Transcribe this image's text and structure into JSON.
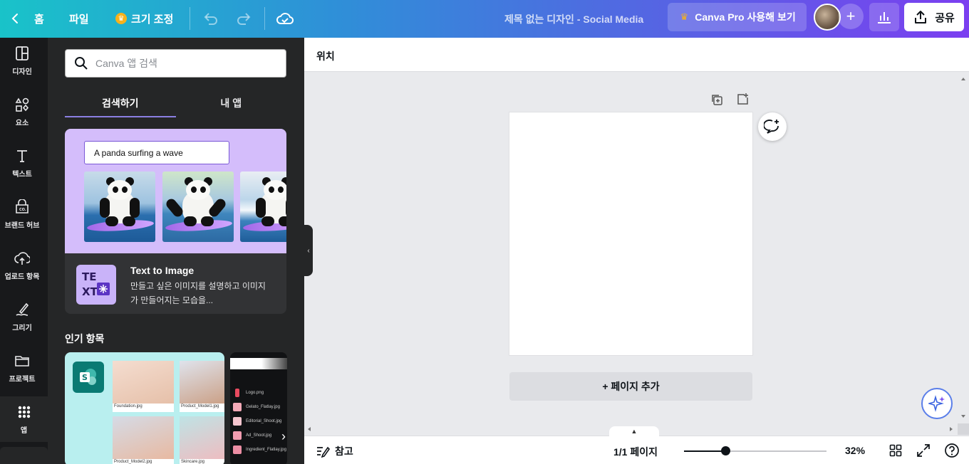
{
  "topbar": {
    "home_label": "홈",
    "file_label": "파일",
    "resize_label": "크기 조정",
    "title": "제목 없는 디자인 - Social Media",
    "pro_label": "Canva Pro 사용해 보기",
    "share_label": "공유"
  },
  "rail": {
    "items": [
      {
        "label": "디자인",
        "icon": "design-icon"
      },
      {
        "label": "요소",
        "icon": "elements-icon"
      },
      {
        "label": "텍스트",
        "icon": "text-icon"
      },
      {
        "label": "브랜드 허브",
        "icon": "brand-hub-icon"
      },
      {
        "label": "업로드 항목",
        "icon": "upload-icon"
      },
      {
        "label": "그리기",
        "icon": "draw-icon"
      },
      {
        "label": "프로젝트",
        "icon": "folder-icon"
      },
      {
        "label": "앱",
        "icon": "apps-grid-icon",
        "active": true
      }
    ]
  },
  "panel": {
    "search_placeholder": "Canva 앱 검색",
    "tabs": [
      {
        "label": "검색하기",
        "active": true
      },
      {
        "label": "내 앱",
        "active": false
      }
    ],
    "t2i": {
      "prompt": "A panda surfing a wave",
      "name": "Text to Image",
      "desc": "만들고 싶은 이미지를 설명하고 이미지가 만들어지는 모습을..."
    },
    "popular_title": "인기 항목",
    "thumbs": [
      {
        "caption": "Foundation.jpg"
      },
      {
        "caption": "Product_Model1.jpg"
      },
      {
        "caption": "Product_Model2.jpg"
      },
      {
        "caption": "Skincare.jpg"
      }
    ],
    "files": [
      "Logo.png",
      "Gelato_Flatlay.jpg",
      "Editorial_Shoot.jpg",
      "Ad_Shoot.jpg",
      "Ingredient_Flatlay.jpg"
    ]
  },
  "workspace": {
    "position_label": "위치",
    "add_page_label": "+ 페이지 추가"
  },
  "bottombar": {
    "notes_label": "참고",
    "pages_label": "1/1 페이지",
    "zoom_label": "32%",
    "zoom_percent": 32
  },
  "colors": {
    "accent": "#8b7fe3",
    "rail_bg": "#18191b",
    "panel_bg": "#252627",
    "canvas_bg": "#e9eaed"
  }
}
